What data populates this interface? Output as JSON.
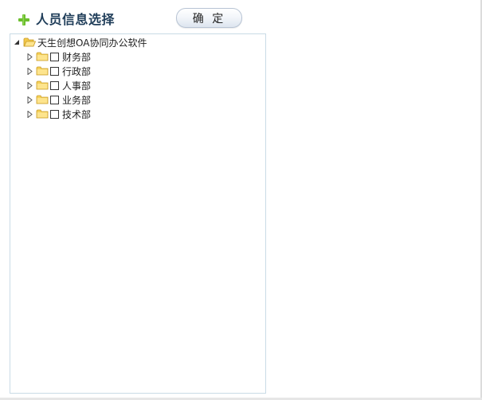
{
  "header": {
    "title": "人员信息选择",
    "confirm_label": "确 定"
  },
  "tree": {
    "root": {
      "label": "天生创想OA协同办公软件",
      "expanded": true
    },
    "departments": [
      {
        "label": "财务部",
        "checked": false,
        "expanded": false
      },
      {
        "label": "行政部",
        "checked": false,
        "expanded": false
      },
      {
        "label": "人事部",
        "checked": false,
        "expanded": false
      },
      {
        "label": "业务部",
        "checked": false,
        "expanded": false
      },
      {
        "label": "技术部",
        "checked": false,
        "expanded": false
      }
    ]
  },
  "colors": {
    "title": "#1f3d59",
    "panel_border": "#c9dbe6",
    "folder": "#f5d15a",
    "plus": "#6cbf2e"
  },
  "icons": {
    "header": "plus-icon",
    "node": "folder-icon",
    "collapsed": "triangle-right-icon",
    "expanded": "triangle-down-icon"
  }
}
